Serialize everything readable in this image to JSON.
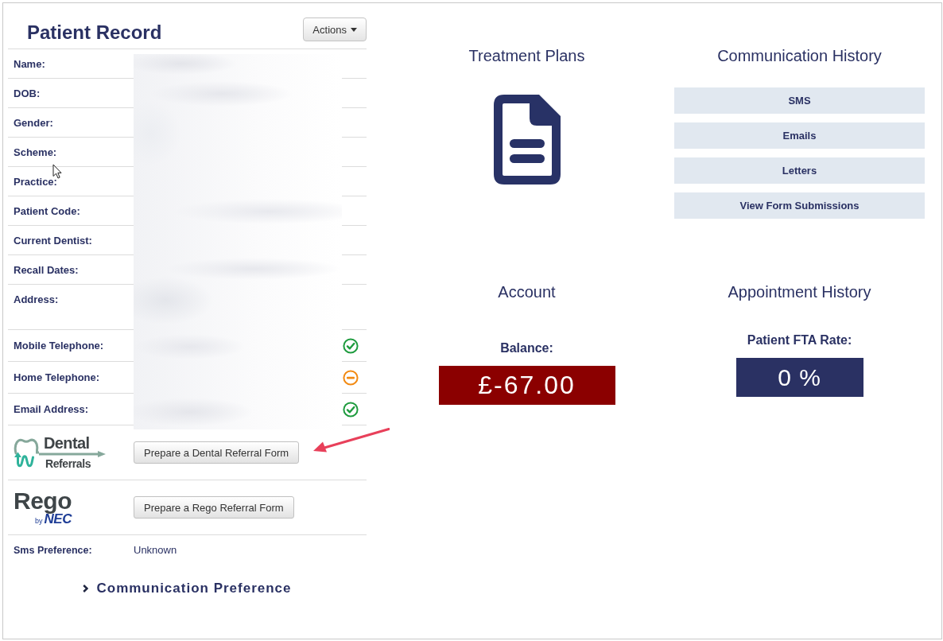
{
  "patient_record": {
    "title": "Patient Record",
    "actions_button": {
      "label": "Actions"
    },
    "fields": [
      {
        "kind": "text",
        "label": "Name:"
      },
      {
        "kind": "text",
        "label": "DOB:"
      },
      {
        "kind": "text",
        "label": "Gender:"
      },
      {
        "kind": "text",
        "label": "Scheme:"
      },
      {
        "kind": "text",
        "label": "Practice:"
      },
      {
        "kind": "text",
        "label": "Patient Code:"
      },
      {
        "kind": "text",
        "label": "Current Dentist:"
      },
      {
        "kind": "text",
        "label": "Recall Dates:"
      },
      {
        "kind": "address",
        "label": "Address:"
      },
      {
        "kind": "contact",
        "label": "Mobile Telephone:",
        "verified": true
      },
      {
        "kind": "contact",
        "label": "Home Telephone:",
        "verified": false
      },
      {
        "kind": "contact",
        "label": "Email Address:",
        "verified": true
      }
    ],
    "referrals": [
      {
        "kind": "dental",
        "logo": [
          "Dental",
          "Referrals"
        ],
        "button": "Prepare a Dental Referral Form"
      },
      {
        "kind": "rego",
        "logo": [
          "Rego",
          "by",
          "NEC"
        ],
        "button": "Prepare a Rego Referral Form"
      }
    ],
    "sms_preference": {
      "label": "Sms Preference:",
      "value": "Unknown"
    },
    "communication_preference": {
      "label": "Communication Preference",
      "expanded": false
    }
  },
  "treatment_plans": {
    "title": "Treatment Plans"
  },
  "communication_history": {
    "title": "Communication History",
    "buttons": [
      "SMS",
      "Emails",
      "Letters",
      "View Form Submissions"
    ]
  },
  "account": {
    "title": "Account",
    "balance_label": "Balance:",
    "balance": "£-67.00"
  },
  "appointment_history": {
    "title": "Appointment History",
    "fta_label": "Patient FTA Rate:",
    "fta_rate": "0 %"
  }
}
